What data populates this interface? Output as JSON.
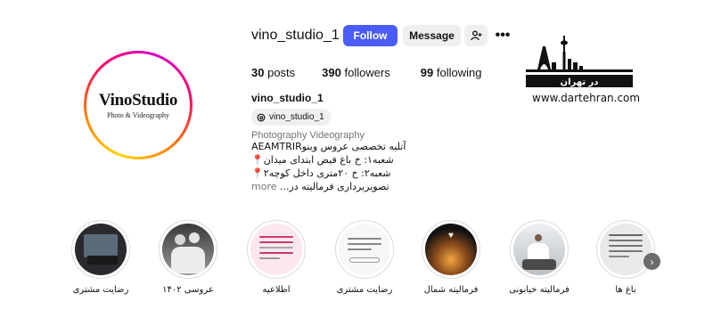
{
  "profile": {
    "username": "vino_studio_1",
    "logo_main": "VinoStudio",
    "logo_sub": "Photo & Videography",
    "display_name": "vino_studio_1",
    "threads_handle": "vino_studio_1",
    "category": "Photography Videography"
  },
  "actions": {
    "follow": "Follow",
    "message": "Message",
    "more": "•••"
  },
  "stats": {
    "posts_count": "30",
    "posts_label": "posts",
    "followers_count": "390",
    "followers_label": "followers",
    "following_count": "99",
    "following_label": "following"
  },
  "bio": {
    "line1": "آتلیه تخصصی عروس وینوAEAMTRIR",
    "line2": "شعبه۱: خ باغ فیض ابتدای میدان📍",
    "line3": "شعبه۲: خ ۲۰متری داخل کوچه۲📍",
    "line4": "تصویربرداری فرمالیته در...",
    "more": " more"
  },
  "watermark": {
    "title": "در تهران",
    "url": "www.dartehran.com"
  },
  "highlights": [
    {
      "label": "رضایت مشتری"
    },
    {
      "label": "عروسی ۱۴۰۲"
    },
    {
      "label": "اطلاعیه"
    },
    {
      "label": "رضایت مشتری"
    },
    {
      "label": "فرمالیته شمال"
    },
    {
      "label": "فرمالیته خیابونی"
    },
    {
      "label": "باغ ها"
    }
  ],
  "colors": {
    "follow_button": "#4a5df9",
    "secondary_button": "#efefef",
    "muted_text": "#737373"
  }
}
